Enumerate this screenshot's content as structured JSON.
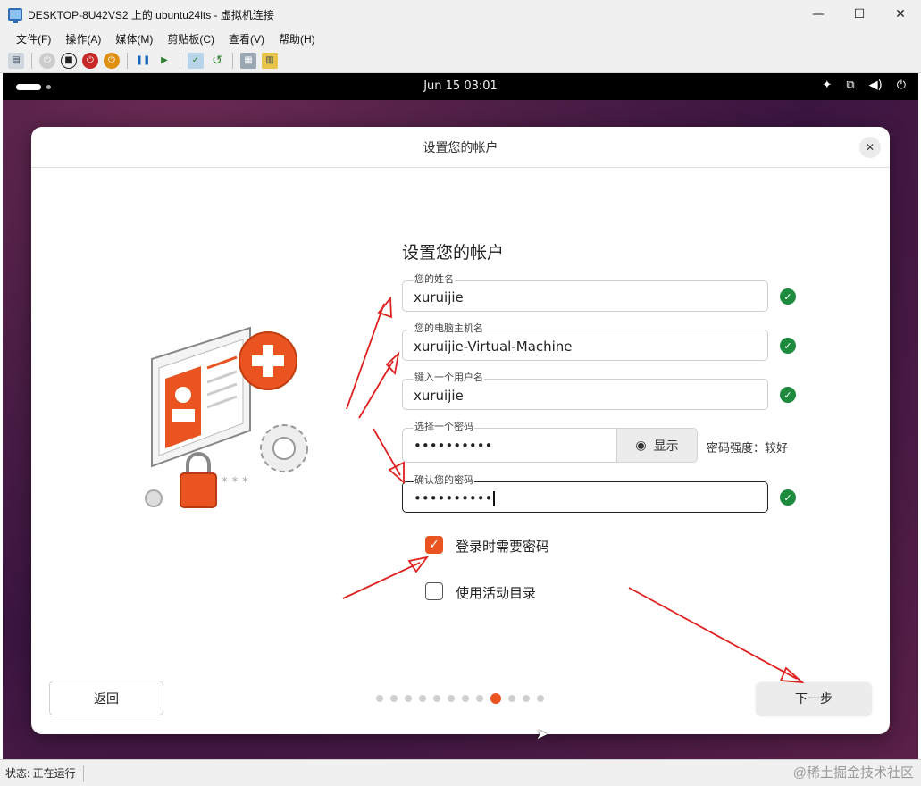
{
  "window": {
    "title": "DESKTOP-8U42VS2 上的 ubuntu24lts - 虚拟机连接",
    "minimize": "—",
    "maximize": "☐",
    "close": "✕"
  },
  "menu": [
    "文件(F)",
    "操作(A)",
    "媒体(M)",
    "剪贴板(C)",
    "查看(V)",
    "帮助(H)"
  ],
  "toolbar_icons": [
    "ctrl-alt-del-icon",
    "start-icon",
    "turn-off-icon",
    "shutdown-icon",
    "save-icon",
    "pause-icon",
    "resume-icon",
    "checkpoint-icon",
    "revert-icon",
    "enhanced-session-icon",
    "share-icon"
  ],
  "topbar": {
    "clock": "Jun 15  03:01"
  },
  "dialog": {
    "header": "设置您的帐户",
    "close": "✕",
    "title": "设置您的帐户",
    "fields": {
      "name": {
        "label": "您的姓名",
        "value": "xuruijie"
      },
      "hostname": {
        "label": "您的电脑主机名",
        "value": "xuruijie-Virtual-Machine"
      },
      "username": {
        "label": "键入一个用户名",
        "value": "xuruijie"
      },
      "password": {
        "label": "选择一个密码",
        "value": "••••••••••"
      },
      "confirm": {
        "label": "确认您的密码",
        "value": "••••••••••"
      }
    },
    "show_button": "显示",
    "strength": "密码强度：较好",
    "checkboxes": {
      "require_password": {
        "label": "登录时需要密码",
        "checked": true
      },
      "active_directory": {
        "label": "使用活动目录",
        "checked": false
      }
    },
    "back": "返回",
    "next": "下一步",
    "progress": {
      "total": 12,
      "current": 9
    }
  },
  "status": {
    "text": "状态: 正在运行"
  },
  "watermark": "@稀土掘金技术社区",
  "colors": {
    "accent": "#e95420",
    "ok": "#1e8a3e",
    "annotation": "#e02020"
  }
}
